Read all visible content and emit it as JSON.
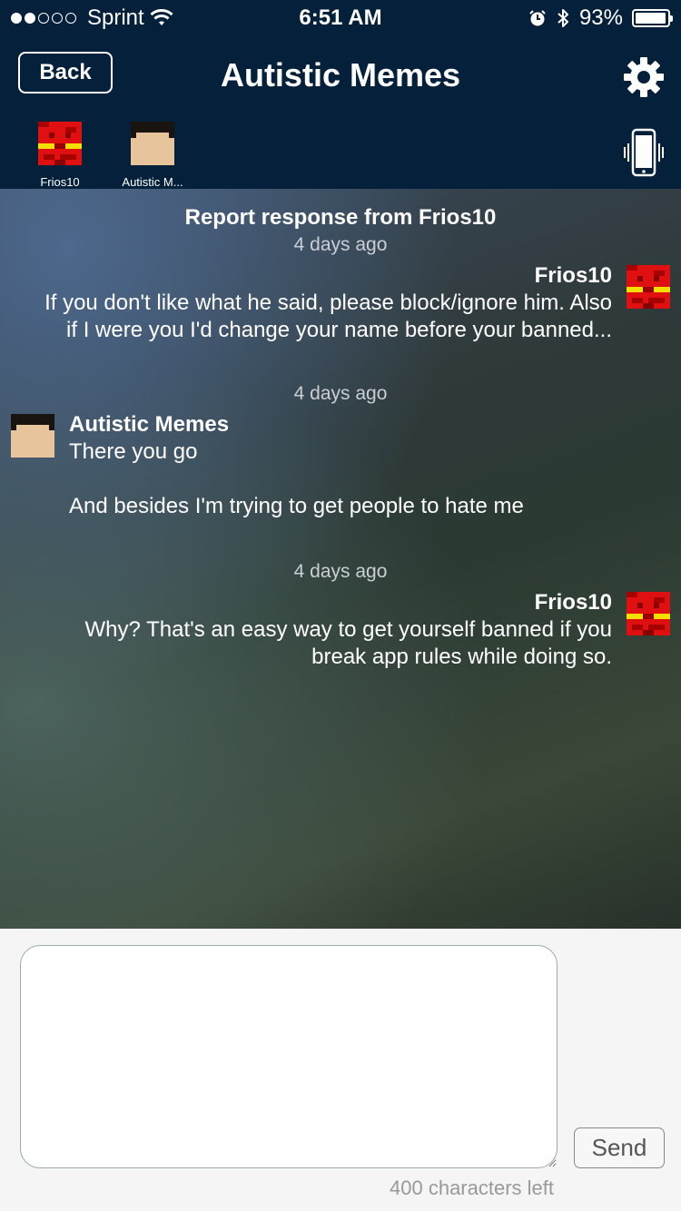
{
  "status_bar": {
    "carrier": "Sprint",
    "time": "6:51 AM",
    "battery": "93%",
    "battery_level": 0.93
  },
  "header": {
    "back_label": "Back",
    "title": "Autistic Memes",
    "settings_icon": "gear-icon",
    "vibrate_icon": "phone-vibrate-icon"
  },
  "members": [
    {
      "name": "Frios10"
    },
    {
      "name": "Autistic M..."
    }
  ],
  "chat": {
    "report_title": "Report response from Frios10",
    "messages": [
      {
        "timestamp": "4 days ago",
        "sender": "Frios10",
        "side": "right",
        "text": "If you don't like what he said, please block/ignore him. Also if I were you I'd change your name before your banned..."
      },
      {
        "timestamp": "4 days ago",
        "sender": "Autistic Memes",
        "side": "left",
        "text": "There you go\n\nAnd besides I'm trying to get people to hate me"
      },
      {
        "timestamp": "4 days ago",
        "sender": "Frios10",
        "side": "right",
        "text": "Why? That's an easy way to get yourself banned if you break app rules while doing so."
      }
    ]
  },
  "composer": {
    "value": "",
    "send_label": "Send",
    "counter": "400 characters left"
  },
  "colors": {
    "header_bg": "#05203a",
    "frios_avatar_red": "#e01010",
    "frios_avatar_yellow": "#f2e000",
    "memes_avatar_skin": "#e8c49c",
    "memes_avatar_hair": "#1a1410"
  }
}
